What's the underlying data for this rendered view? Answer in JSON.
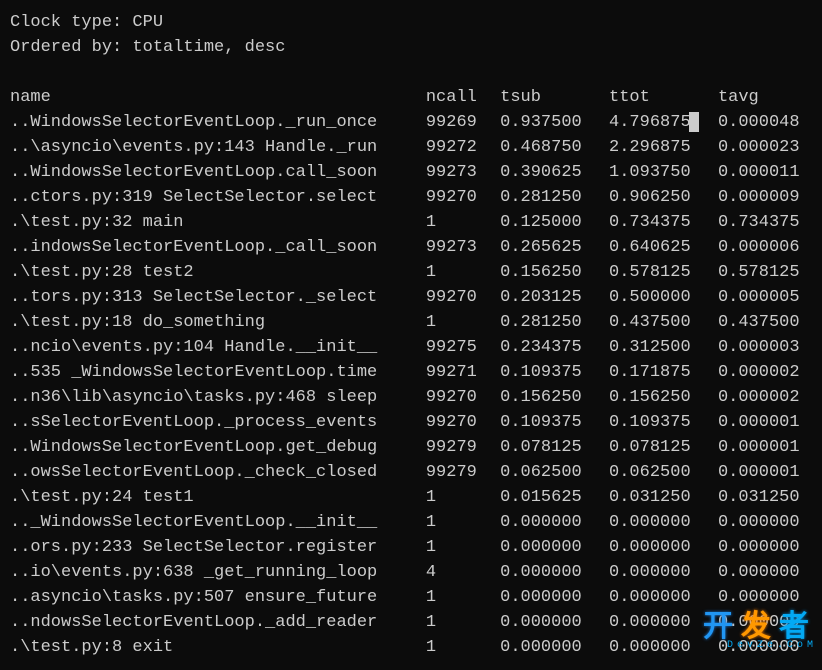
{
  "header": {
    "clock_type_label": "Clock type: CPU",
    "ordered_by_label": "Ordered by: totaltime, desc"
  },
  "columns": {
    "name": "name",
    "ncall": "ncall",
    "tsub": "tsub",
    "ttot": "ttot",
    "tavg": "tavg"
  },
  "rows": [
    {
      "name": "..WindowsSelectorEventLoop._run_once",
      "ncall": "99269",
      "tsub": "0.937500",
      "ttot": "4.796875",
      "tavg": "0.000048",
      "cursor": true
    },
    {
      "name": "..\\asyncio\\events.py:143 Handle._run",
      "ncall": "99272",
      "tsub": "0.468750",
      "ttot": "2.296875",
      "tavg": "0.000023"
    },
    {
      "name": "..WindowsSelectorEventLoop.call_soon",
      "ncall": "99273",
      "tsub": "0.390625",
      "ttot": "1.093750",
      "tavg": "0.000011"
    },
    {
      "name": "..ctors.py:319 SelectSelector.select",
      "ncall": "99270",
      "tsub": "0.281250",
      "ttot": "0.906250",
      "tavg": "0.000009"
    },
    {
      "name": ".\\test.py:32 main",
      "ncall": "1",
      "tsub": "0.125000",
      "ttot": "0.734375",
      "tavg": "0.734375"
    },
    {
      "name": "..indowsSelectorEventLoop._call_soon",
      "ncall": "99273",
      "tsub": "0.265625",
      "ttot": "0.640625",
      "tavg": "0.000006"
    },
    {
      "name": ".\\test.py:28 test2",
      "ncall": "1",
      "tsub": "0.156250",
      "ttot": "0.578125",
      "tavg": "0.578125"
    },
    {
      "name": "..tors.py:313 SelectSelector._select",
      "ncall": "99270",
      "tsub": "0.203125",
      "ttot": "0.500000",
      "tavg": "0.000005"
    },
    {
      "name": ".\\test.py:18 do_something",
      "ncall": "1",
      "tsub": "0.281250",
      "ttot": "0.437500",
      "tavg": "0.437500"
    },
    {
      "name": "..ncio\\events.py:104 Handle.__init__",
      "ncall": "99275",
      "tsub": "0.234375",
      "ttot": "0.312500",
      "tavg": "0.000003"
    },
    {
      "name": "..535 _WindowsSelectorEventLoop.time",
      "ncall": "99271",
      "tsub": "0.109375",
      "ttot": "0.171875",
      "tavg": "0.000002"
    },
    {
      "name": "..n36\\lib\\asyncio\\tasks.py:468 sleep",
      "ncall": "99270",
      "tsub": "0.156250",
      "ttot": "0.156250",
      "tavg": "0.000002"
    },
    {
      "name": "..sSelectorEventLoop._process_events",
      "ncall": "99270",
      "tsub": "0.109375",
      "ttot": "0.109375",
      "tavg": "0.000001"
    },
    {
      "name": "..WindowsSelectorEventLoop.get_debug",
      "ncall": "99279",
      "tsub": "0.078125",
      "ttot": "0.078125",
      "tavg": "0.000001"
    },
    {
      "name": "..owsSelectorEventLoop._check_closed",
      "ncall": "99279",
      "tsub": "0.062500",
      "ttot": "0.062500",
      "tavg": "0.000001"
    },
    {
      "name": ".\\test.py:24 test1",
      "ncall": "1",
      "tsub": "0.015625",
      "ttot": "0.031250",
      "tavg": "0.031250"
    },
    {
      "name": ".._WindowsSelectorEventLoop.__init__",
      "ncall": "1",
      "tsub": "0.000000",
      "ttot": "0.000000",
      "tavg": "0.000000"
    },
    {
      "name": "..ors.py:233 SelectSelector.register",
      "ncall": "1",
      "tsub": "0.000000",
      "ttot": "0.000000",
      "tavg": "0.000000"
    },
    {
      "name": "..io\\events.py:638 _get_running_loop",
      "ncall": "4",
      "tsub": "0.000000",
      "ttot": "0.000000",
      "tavg": "0.000000"
    },
    {
      "name": "..asyncio\\tasks.py:507 ensure_future",
      "ncall": "1",
      "tsub": "0.000000",
      "ttot": "0.000000",
      "tavg": "0.000000"
    },
    {
      "name": "..ndowsSelectorEventLoop._add_reader",
      "ncall": "1",
      "tsub": "0.000000",
      "ttot": "0.000000",
      "tavg": "0.000000"
    },
    {
      "name": ".\\test.py:8 exit",
      "ncall": "1",
      "tsub": "0.000000",
      "ttot": "0.000000",
      "tavg": "0.000000"
    }
  ],
  "watermark": {
    "char1": "开",
    "char2": "发",
    "char3": "者",
    "sub": "DevZe.CoM"
  }
}
